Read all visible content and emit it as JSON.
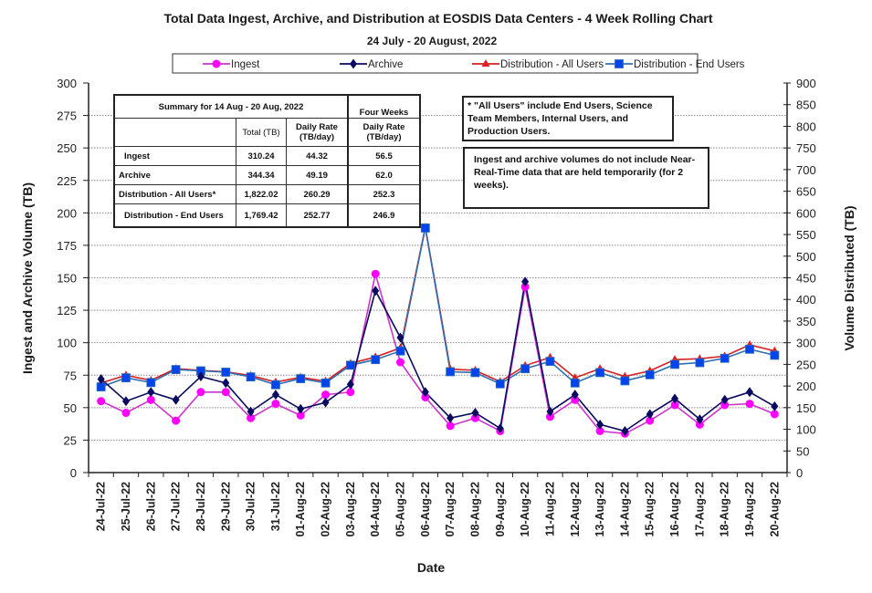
{
  "chart_data": {
    "type": "line",
    "title": "Total Data Ingest, Archive, and  Distribution at EOSDIS Data Centers - 4 Week Rolling Chart",
    "subtitle": "24 July  -  20  August,  2022",
    "xlabel": "Date",
    "ylabel": "Ingest and Archive Volume (TB)",
    "y2label": "Volume Distributed (TB)",
    "ylim": [
      0,
      300
    ],
    "y2lim": [
      0,
      900
    ],
    "yticks": [
      0,
      25,
      50,
      75,
      100,
      125,
      150,
      175,
      200,
      225,
      250,
      275,
      300
    ],
    "y2ticks": [
      0,
      50,
      100,
      150,
      200,
      250,
      300,
      350,
      400,
      450,
      500,
      550,
      600,
      650,
      700,
      750,
      800,
      850,
      900
    ],
    "grid": "horizontal dotted",
    "legend_position": "top-center",
    "categories": [
      "24-Jul-22",
      "25-Jul-22",
      "26-Jul-22",
      "27-Jul-22",
      "28-Jul-22",
      "29-Jul-22",
      "30-Jul-22",
      "31-Jul-22",
      "01-Aug-22",
      "02-Aug-22",
      "03-Aug-22",
      "04-Aug-22",
      "05-Aug-22",
      "06-Aug-22",
      "07-Aug-22",
      "08-Aug-22",
      "09-Aug-22",
      "10-Aug-22",
      "11-Aug-22",
      "12-Aug-22",
      "13-Aug-22",
      "14-Aug-22",
      "15-Aug-22",
      "16-Aug-22",
      "17-Aug-22",
      "18-Aug-22",
      "19-Aug-22",
      "20-Aug-22"
    ],
    "series": [
      {
        "name": "Ingest",
        "axis": "left",
        "color": "#ff00ff",
        "line_color": "#cc33cc",
        "marker": "circle",
        "values": [
          55,
          46,
          56,
          40,
          62,
          62,
          42,
          53,
          44,
          60,
          62,
          153,
          85,
          58,
          36,
          42,
          32,
          143,
          43,
          56,
          32,
          30,
          40,
          52,
          37,
          52,
          53,
          45
        ]
      },
      {
        "name": "Archive",
        "axis": "left",
        "color": "#0a0a60",
        "line_color": "#0a0a60",
        "marker": "diamond",
        "values": [
          72,
          55,
          62,
          56,
          74,
          69,
          47,
          60,
          49,
          54,
          68,
          140,
          104,
          62,
          42,
          46,
          34,
          147,
          47,
          60,
          37,
          32,
          45,
          57,
          41,
          56,
          62,
          51
        ]
      },
      {
        "name": "Distribution - All Users",
        "axis": "right",
        "color": "#e02020",
        "line_color": "#d62020",
        "marker": "triangle",
        "values": [
          207,
          225,
          213,
          240,
          236,
          233,
          224,
          209,
          220,
          211,
          252,
          267,
          288,
          567,
          239,
          236,
          210,
          247,
          266,
          219,
          240,
          222,
          235,
          261,
          263,
          269,
          295,
          281
        ]
      },
      {
        "name": "Distribution - End Users",
        "axis": "right",
        "color": "#0044ee",
        "line_color": "#2f6fb0",
        "marker": "square",
        "values": [
          198,
          219,
          208,
          238,
          235,
          232,
          221,
          203,
          217,
          207,
          248,
          261,
          281,
          565,
          233,
          231,
          205,
          240,
          257,
          207,
          231,
          212,
          226,
          250,
          254,
          264,
          285,
          271
        ]
      }
    ]
  },
  "summary_table": {
    "title": "Summary for  14 Aug  -  20 Aug,  2022",
    "four_weeks_header": "Four Weeks",
    "col_total": "Total (TB)",
    "col_daily": "Daily Rate (TB/day)",
    "col_four_daily": "Daily Rate (TB/day)",
    "rows": [
      {
        "label": "Ingest",
        "total": "310.24",
        "daily": "44.32",
        "four_weeks": "56.5"
      },
      {
        "label": "Archive",
        "total": "344.34",
        "daily": "49.19",
        "four_weeks": "62.0"
      },
      {
        "label": "Distribution - All Users*",
        "total": "1,822.02",
        "daily": "260.29",
        "four_weeks": "252.3"
      },
      {
        "label": "Distribution - End Users",
        "total": "1,769.42",
        "daily": "252.77",
        "four_weeks": "246.9"
      }
    ]
  },
  "notes": {
    "all_users": "* \"All Users\" include End Users, Science Team Members,  Internal Users, and Production Users.",
    "nrt": "Ingest and archive volumes do not include Near-Real-Time data that are held temporarily (for 2 weeks)."
  }
}
